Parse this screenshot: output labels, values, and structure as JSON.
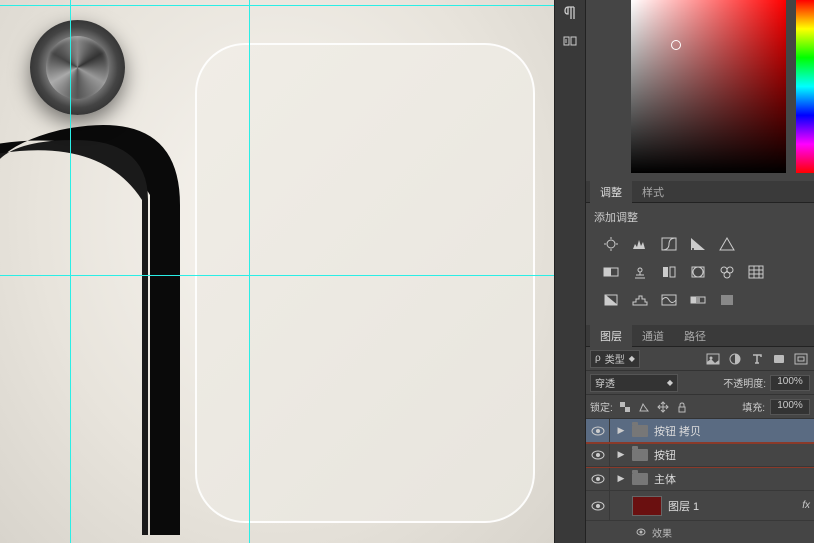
{
  "adjustments": {
    "tab_adjust": "调整",
    "tab_styles": "样式",
    "title": "添加调整"
  },
  "layers_panel": {
    "tab_layers": "图层",
    "tab_channels": "通道",
    "tab_paths": "路径",
    "type_filter_prefix": "ρ",
    "type_filter_label": "类型",
    "blend_mode": "穿透",
    "opacity_label": "不透明度:",
    "opacity_value": "100%",
    "lock_label": "锁定:",
    "fill_label": "填充:",
    "fill_value": "100%"
  },
  "layers": [
    {
      "name": "按钮 拷贝",
      "type": "folder",
      "selected": true
    },
    {
      "name": "按钮",
      "type": "folder",
      "highlighted": true
    },
    {
      "name": "主体",
      "type": "folder"
    },
    {
      "name": "图层 1",
      "type": "layer",
      "thumb": "#6a1010",
      "fx": true
    }
  ],
  "effects_label": "效果"
}
